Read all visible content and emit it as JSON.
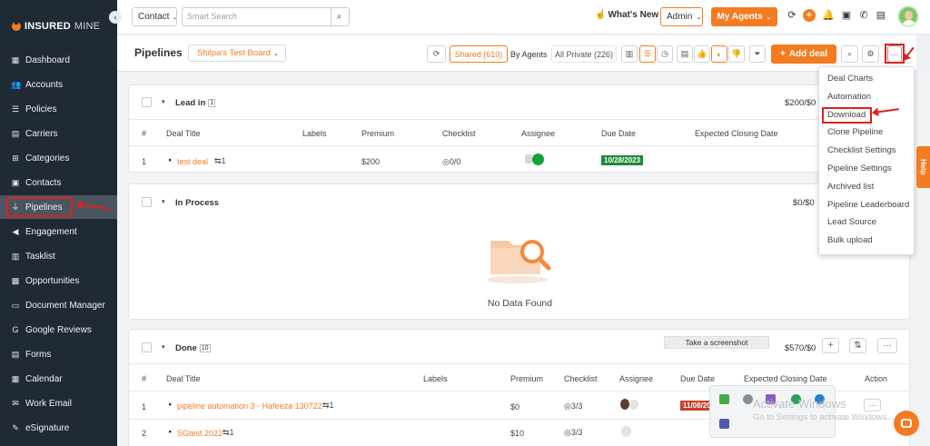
{
  "brand": {
    "logo_left": "INSURED",
    "logo_right": "MINE",
    "accent": "#f47b20",
    "highlight": "#e0201d"
  },
  "sidebar": {
    "items": [
      {
        "label": "Dashboard",
        "icon": "grid-icon",
        "glyph": "▦"
      },
      {
        "label": "Accounts",
        "icon": "users-icon",
        "glyph": "👥"
      },
      {
        "label": "Policies",
        "icon": "list-icon",
        "glyph": "☰"
      },
      {
        "label": "Carriers",
        "icon": "briefcase-icon",
        "glyph": "▤"
      },
      {
        "label": "Categories",
        "icon": "tag-icon",
        "glyph": "⊞"
      },
      {
        "label": "Contacts",
        "icon": "contact-card-icon",
        "glyph": "▣"
      },
      {
        "label": "Pipelines",
        "icon": "funnel-icon",
        "glyph": "⏚",
        "active": true
      },
      {
        "label": "Engagement",
        "icon": "megaphone-icon",
        "glyph": "◀"
      },
      {
        "label": "Tasklist",
        "icon": "clipboard-icon",
        "glyph": "▥"
      },
      {
        "label": "Opportunities",
        "icon": "chart-icon",
        "glyph": "▩"
      },
      {
        "label": "Document Manager",
        "icon": "folder-icon",
        "glyph": "▭"
      },
      {
        "label": "Google Reviews",
        "icon": "google-icon",
        "glyph": "G"
      },
      {
        "label": "Forms",
        "icon": "form-icon",
        "glyph": "▤"
      },
      {
        "label": "Calendar",
        "icon": "calendar-icon",
        "glyph": "▦"
      },
      {
        "label": "Work Email",
        "icon": "mail-icon",
        "glyph": "✉"
      },
      {
        "label": "eSignature",
        "icon": "signature-icon",
        "glyph": "✎"
      }
    ]
  },
  "topbar": {
    "contact_select": "Contact",
    "search_placeholder": "Smart Search",
    "whats_new": "What's New",
    "admin": "Admin",
    "my_agents": "My Agents"
  },
  "subheader": {
    "title": "Pipelines",
    "board": "Shilpa's Test Board",
    "shared": "Shared (610)",
    "by_agents": "By Agents",
    "all_private": "All Private (226)",
    "add_deal": "Add deal",
    "more": "···"
  },
  "menu": {
    "items": [
      "Deal Charts",
      "Automation",
      "Download",
      "Clone Pipeline",
      "Checklist Settings",
      "Pipeline Settings",
      "Archived list",
      "Pipeline Leaderboard",
      "Lead Source",
      "Bulk upload"
    ]
  },
  "groups": {
    "lead_in": {
      "title": "Lead in",
      "count": "1",
      "amount": "$200/$0",
      "headers": [
        "#",
        "Deal Title",
        "Labels",
        "Premium",
        "Checklist",
        "Assignee",
        "Due Date",
        "Expected Closing Date"
      ],
      "rows": [
        {
          "num": "1",
          "title": "test deal",
          "links": "⇆1",
          "premium": "$200",
          "checklist": "0/0",
          "due": "10/28/2023"
        }
      ]
    },
    "in_process": {
      "title": "In Process",
      "amount": "$0/$0",
      "empty": "No Data Found"
    },
    "done": {
      "title": "Done",
      "count": "10",
      "amount": "$570/$0",
      "headers": [
        "#",
        "Deal Title",
        "Labels",
        "Premium",
        "Checklist",
        "Assignee",
        "Due Date",
        "Expected Closing Date",
        "Action"
      ],
      "rows": [
        {
          "num": "1",
          "title": "pipeline automation 3 - Hafeeza 130722",
          "links": "⇆1",
          "premium": "$0",
          "checklist": "3/3",
          "due": "11/08/202"
        },
        {
          "num": "2",
          "title": "SGtest 2022",
          "links": "⇆1",
          "premium": "$10",
          "checklist": "3/3",
          "due": ""
        }
      ]
    }
  },
  "overlay": {
    "screenshot_tip": "Take a screenshot",
    "watermark_title": "Activate Windows",
    "watermark_sub": "Go to Settings to activate Windows.",
    "help": "Help"
  }
}
